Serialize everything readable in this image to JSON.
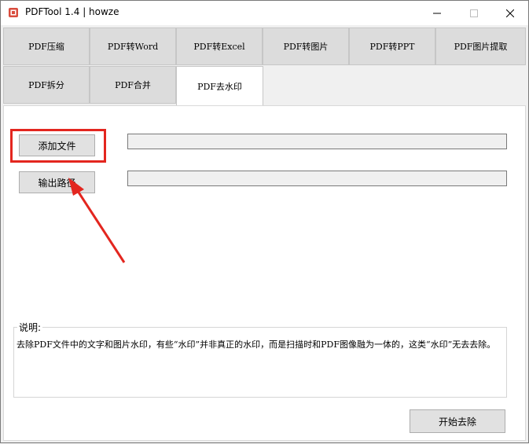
{
  "window": {
    "title": "PDFTool 1.4 |  howze",
    "minimize_icon": "minimize-icon",
    "maximize_icon": "maximize-icon",
    "close_icon": "close-icon"
  },
  "tabs": {
    "row1": [
      "PDF压缩",
      "PDF转Word",
      "PDF转Excel",
      "PDF转图片",
      "PDF转PPT",
      "PDF图片提取"
    ],
    "row2": [
      "PDF拆分",
      "PDF合并",
      "PDF去水印"
    ],
    "active": "PDF去水印"
  },
  "panel": {
    "add_file_label": "添加文件",
    "output_path_label": "输出路径",
    "add_file_value": "",
    "output_path_value": "",
    "description_label": "说明:",
    "description_text": "去除PDF文件中的文字和图片水印，有些“水印”并非真正的水印，而是扫描时和PDF图像融为一体的，这类“水印”无去去除。",
    "start_label": "开始去除"
  },
  "colors": {
    "highlight": "#e3261f",
    "arrow": "#e3261f"
  }
}
